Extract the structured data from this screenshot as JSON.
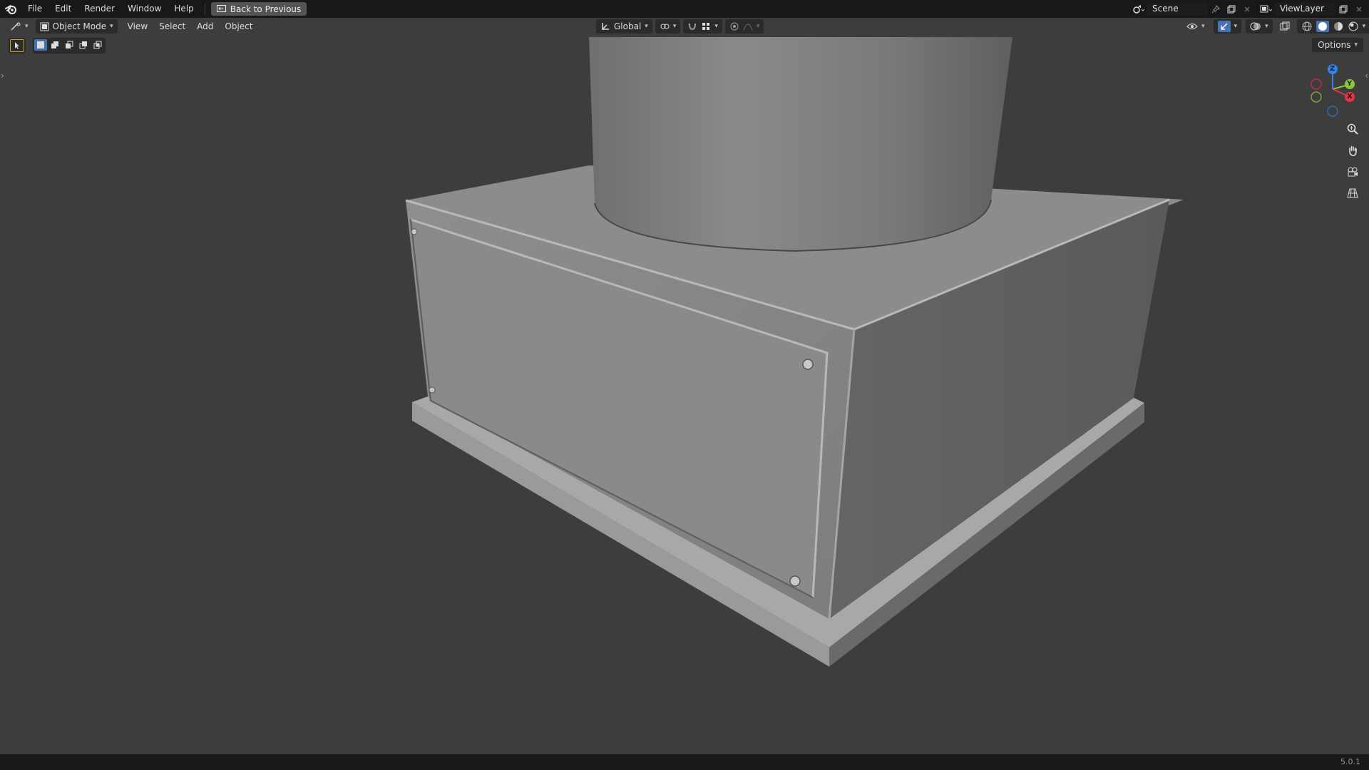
{
  "menubar": {
    "items": [
      "File",
      "Edit",
      "Render",
      "Window",
      "Help"
    ],
    "back_label": "Back to Previous"
  },
  "scene": {
    "name": "Scene"
  },
  "view_layer": {
    "name": "ViewLayer"
  },
  "viewport_header": {
    "mode": "Object Mode",
    "menus": [
      "View",
      "Select",
      "Add",
      "Object"
    ],
    "orientation": "Global"
  },
  "options_label": "Options",
  "gizmo": {
    "z": "Z",
    "y": "Y",
    "x": "X"
  },
  "version": "5.0.1",
  "colors": {
    "accent": "#4772b3",
    "axis_x": "#e0364a",
    "axis_y": "#8cc43b",
    "axis_z": "#2f86e3",
    "viewport_bg": "#3d3d3d"
  }
}
